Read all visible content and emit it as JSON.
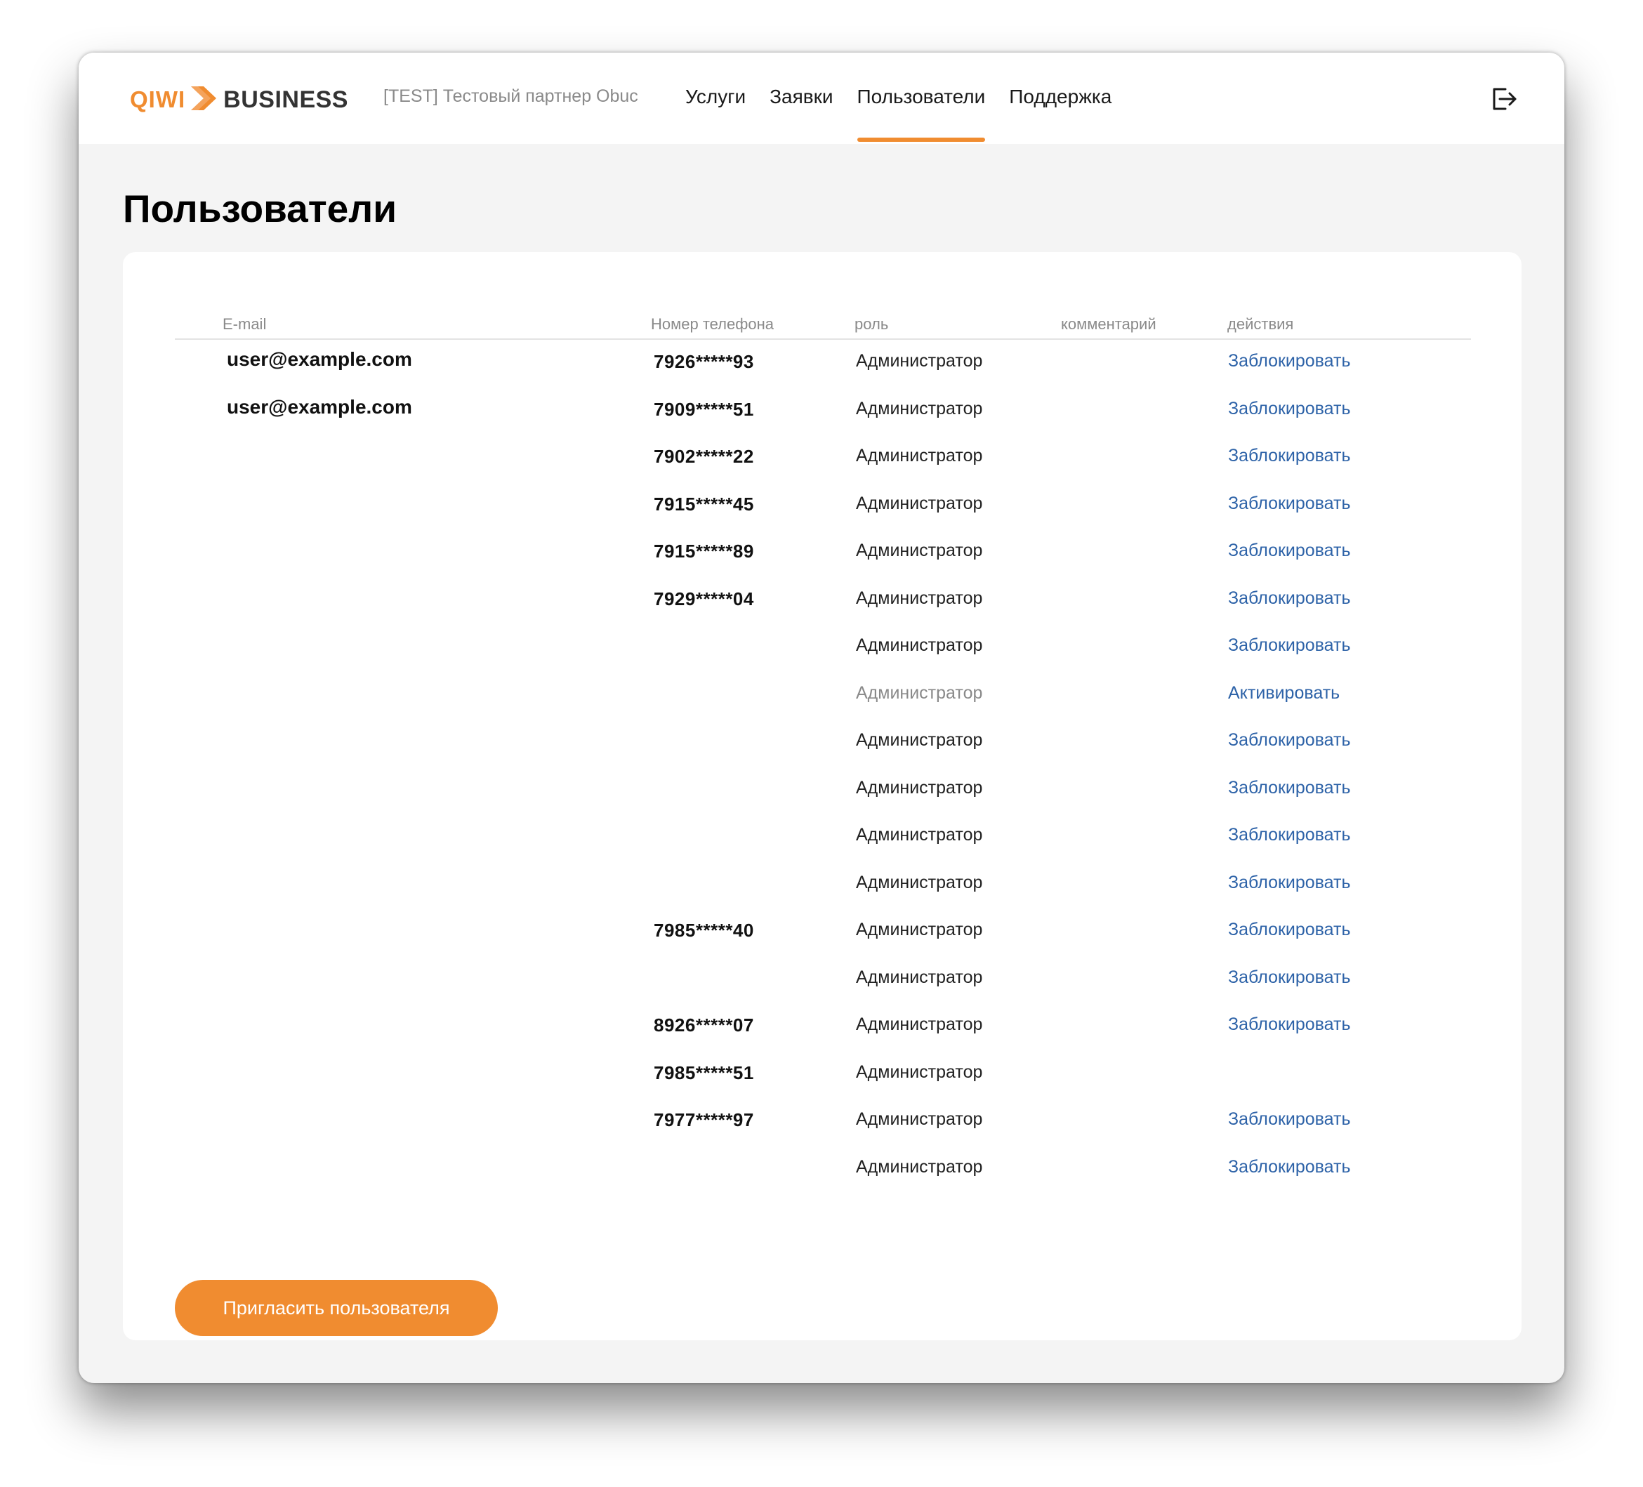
{
  "header": {
    "logo_qiwi": "QIWI",
    "logo_business": "BUSINESS",
    "partner": "[TEST] Тестовый партнер Obuc",
    "nav": [
      {
        "label": "Услуги",
        "active": false
      },
      {
        "label": "Заявки",
        "active": false
      },
      {
        "label": "Пользователи",
        "active": true
      },
      {
        "label": "Поддержка",
        "active": false
      }
    ],
    "logout_icon": "logout-icon"
  },
  "page": {
    "title": "Пользователи"
  },
  "table": {
    "columns": {
      "email": "E-mail",
      "phone": "Номер телефона",
      "role": "роль",
      "comment": "комментарий",
      "actions": "действия"
    },
    "rows": [
      {
        "email": "user@example.com",
        "phone": "7926*****93",
        "role": "Администратор",
        "comment": "",
        "action": "Заблокировать",
        "muted": false
      },
      {
        "email": "user@example.com",
        "phone": "7909*****51",
        "role": "Администратор",
        "comment": "",
        "action": "Заблокировать",
        "muted": false
      },
      {
        "email": "",
        "phone": "7902*****22",
        "role": "Администратор",
        "comment": "",
        "action": "Заблокировать",
        "muted": false
      },
      {
        "email": "",
        "phone": "7915*****45",
        "role": "Администратор",
        "comment": "",
        "action": "Заблокировать",
        "muted": false
      },
      {
        "email": "",
        "phone": "7915*****89",
        "role": "Администратор",
        "comment": "",
        "action": "Заблокировать",
        "muted": false
      },
      {
        "email": "",
        "phone": "7929*****04",
        "role": "Администратор",
        "comment": "",
        "action": "Заблокировать",
        "muted": false
      },
      {
        "email": "",
        "phone": "",
        "role": "Администратор",
        "comment": "",
        "action": "Заблокировать",
        "muted": false
      },
      {
        "email": "",
        "phone": "",
        "role": "Администратор",
        "comment": "",
        "action": "Активировать",
        "muted": true
      },
      {
        "email": "",
        "phone": "",
        "role": "Администратор",
        "comment": "",
        "action": "Заблокировать",
        "muted": false
      },
      {
        "email": "",
        "phone": "",
        "role": "Администратор",
        "comment": "",
        "action": "Заблокировать",
        "muted": false
      },
      {
        "email": "",
        "phone": "",
        "role": "Администратор",
        "comment": "",
        "action": "Заблокировать",
        "muted": false
      },
      {
        "email": "",
        "phone": "",
        "role": "Администратор",
        "comment": "",
        "action": "Заблокировать",
        "muted": false
      },
      {
        "email": "",
        "phone": "7985*****40",
        "role": "Администратор",
        "comment": "",
        "action": "Заблокировать",
        "muted": false
      },
      {
        "email": "",
        "phone": "",
        "role": "Администратор",
        "comment": "",
        "action": "Заблокировать",
        "muted": false
      },
      {
        "email": "",
        "phone": "8926*****07",
        "role": "Администратор",
        "comment": "",
        "action": "Заблокировать",
        "muted": false
      },
      {
        "email": "",
        "phone": "7985*****51",
        "role": "Администратор",
        "comment": "",
        "action": "",
        "muted": false
      },
      {
        "email": "",
        "phone": "7977*****97",
        "role": "Администратор",
        "comment": "",
        "action": "Заблокировать",
        "muted": false
      },
      {
        "email": "",
        "phone": "",
        "role": "Администратор",
        "comment": "",
        "action": "Заблокировать",
        "muted": false
      }
    ]
  },
  "invite_button": "Пригласить пользователя",
  "colors": {
    "accent": "#f08c30",
    "link": "#2e63a8",
    "muted": "#8a8a8a",
    "background": "#f4f4f4"
  }
}
